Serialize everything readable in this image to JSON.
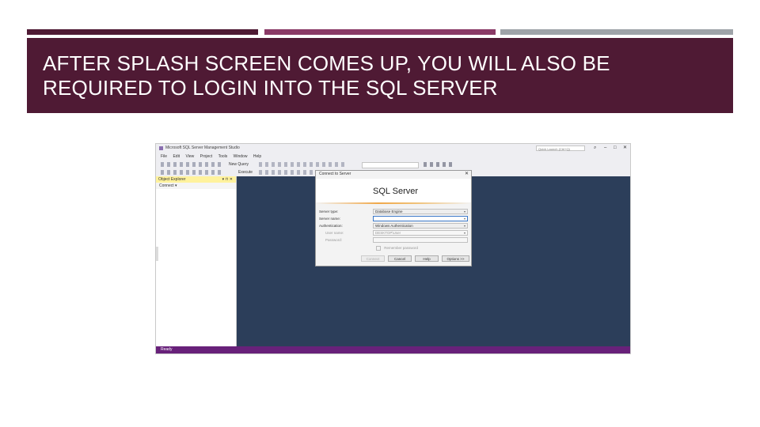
{
  "slide": {
    "title": "AFTER SPLASH SCREEN COMES UP,  YOU WILL  ALSO BE REQUIRED TO LOGIN INTO THE SQL SERVER"
  },
  "colors": {
    "band": "#4f1a34",
    "bar_middle": "#8a3a66",
    "bar_right": "#9ea3a8",
    "ssms_background": "#2c3e5a",
    "status_bar": "#68217a"
  },
  "ssms": {
    "window_title": "Microsoft SQL Server Management Studio",
    "quick_launch_placeholder": "Quick Launch (Ctrl+Q)",
    "menu": [
      "File",
      "Edit",
      "View",
      "Project",
      "Tools",
      "Window",
      "Help"
    ],
    "toolbar": {
      "new_query": "New Query",
      "execute": "Execute"
    },
    "object_explorer": {
      "title": "Object Explorer",
      "pin": "▾ ⊓ ✕",
      "toolbar": "Connect ▾"
    },
    "status": "Ready",
    "dialog": {
      "title": "Connect to Server",
      "close": "✕",
      "banner": "SQL Server",
      "fields": {
        "server_type": {
          "label": "Server type:",
          "value": "Database Engine"
        },
        "server_name": {
          "label": "Server name:",
          "value": ""
        },
        "authentication": {
          "label": "Authentication:",
          "value": "Windows Authentication"
        },
        "user_name": {
          "label": "User name:",
          "value": "DESKTOP\\User"
        },
        "password": {
          "label": "Password:",
          "value": ""
        }
      },
      "remember_password": "Remember password",
      "buttons": {
        "connect": "Connect",
        "cancel": "Cancel",
        "help": "Help",
        "options": "Options >>"
      }
    }
  }
}
